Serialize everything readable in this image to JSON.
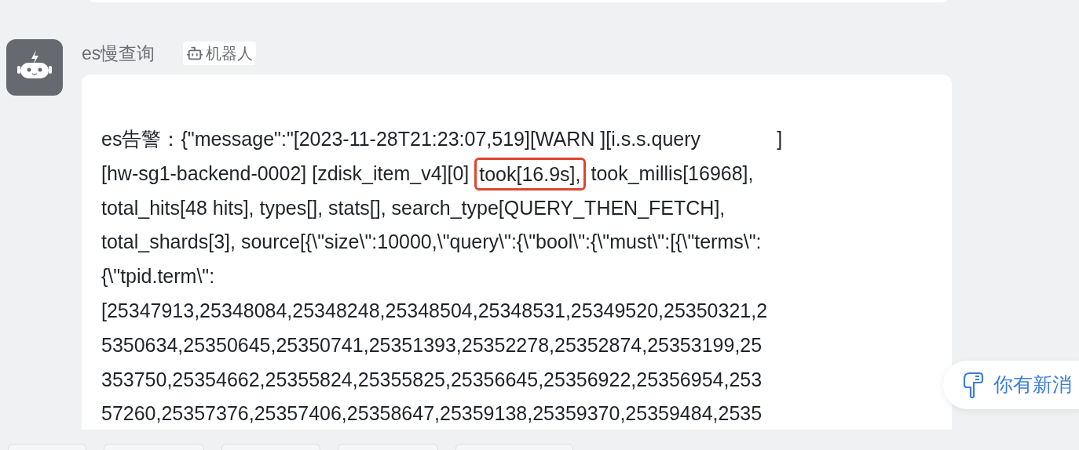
{
  "sender": {
    "name": "es慢查询",
    "tag": "机器人"
  },
  "message": {
    "lines": [
      [
        {
          "text": "es告警：{\"message\":\"[2023-11-28T21:23:07,519][WARN ][i.s.s.query              ]",
          "highlighted": false
        }
      ],
      [
        {
          "text": "[hw-sg1-backend-0002] [zdisk_item_v4][0] ",
          "highlighted": false
        },
        {
          "text": "took[16.9s],",
          "highlighted": true
        },
        {
          "text": " took_millis[16968],",
          "highlighted": false
        }
      ],
      [
        {
          "text": "total_hits[48 hits], types[], stats[], search_type[QUERY_THEN_FETCH],",
          "highlighted": false
        }
      ],
      [
        {
          "text": "total_shards[3], source[{\\\"size\\\":10000,\\\"query\\\":{\\\"bool\\\":{\\\"must\\\":[{\\\"terms\\\":",
          "highlighted": false
        }
      ],
      [
        {
          "text": "{\\\"tpid.term\\\":",
          "highlighted": false
        }
      ],
      [
        {
          "text": "[25347913,25348084,25348248,25348504,25348531,25349520,25350321,2",
          "highlighted": false
        }
      ],
      [
        {
          "text": "5350634,25350645,25350741,25351393,25352278,25352874,25353199,25",
          "highlighted": false
        }
      ],
      [
        {
          "text": "353750,25354662,25355824,25355825,25356645,25356922,25356954,253",
          "highlighted": false
        }
      ],
      [
        {
          "text": "57260,25357376,25357406,25358647,25359138,25359370,25359484,2535",
          "highlighted": false
        }
      ]
    ]
  },
  "notification": {
    "label": "你有新消"
  }
}
